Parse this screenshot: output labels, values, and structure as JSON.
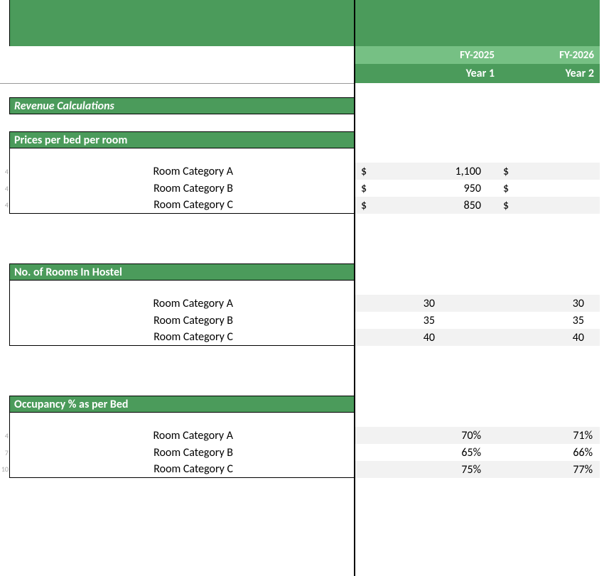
{
  "header": {
    "fy2025": "FY-2025",
    "fy2026": "FY-2026",
    "year1": "Year 1",
    "year2": "Year 2"
  },
  "sections": {
    "revenue_title": "Revenue Calculations",
    "prices_title": "Prices per bed per room",
    "rooms_title": "No. of Rooms In Hostel",
    "occupancy_title": "Occupancy % as per Bed"
  },
  "currency": "$",
  "prices": {
    "catA": {
      "label": "Room Category A",
      "rownum": "4",
      "y1": "1,100"
    },
    "catB": {
      "label": "Room Category B",
      "rownum": "4",
      "y1": "950"
    },
    "catC": {
      "label": "Room Category C",
      "rownum": "4",
      "y1": "850"
    }
  },
  "rooms": {
    "catA": {
      "label": "Room Category A",
      "y1": "30",
      "y2": "30"
    },
    "catB": {
      "label": "Room Category B",
      "y1": "35",
      "y2": "35"
    },
    "catC": {
      "label": "Room Category C",
      "y1": "40",
      "y2": "40"
    }
  },
  "occupancy": {
    "catA": {
      "label": "Room Category A",
      "rownum": "4",
      "y1": "70%",
      "y2": "71%"
    },
    "catB": {
      "label": "Room Category B",
      "rownum": "7",
      "y1": "65%",
      "y2": "66%"
    },
    "catC": {
      "label": "Room Category C",
      "rownum": "10",
      "y1": "75%",
      "y2": "77%"
    }
  }
}
